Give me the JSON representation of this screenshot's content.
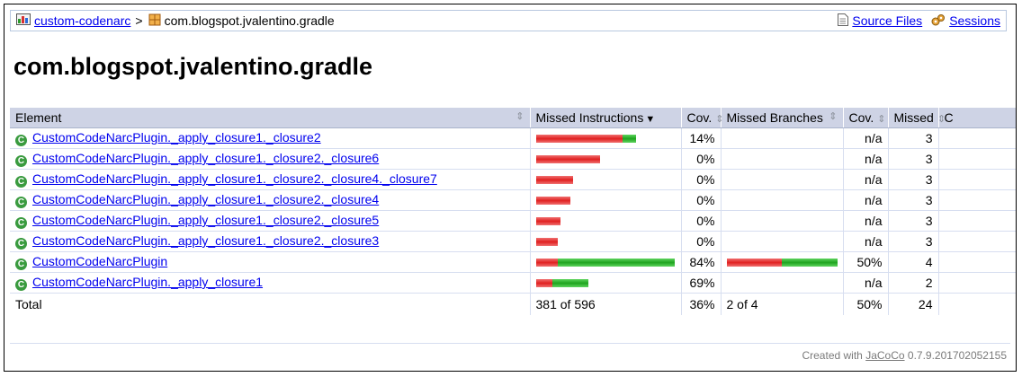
{
  "breadcrumb": {
    "root_label": "custom-codenarc",
    "separator": ">",
    "package_label": "com.blogspot.jvalentino.gradle",
    "source_files_label": "Source Files",
    "sessions_label": "Sessions"
  },
  "page_title": "com.blogspot.jvalentino.gradle",
  "table": {
    "headers": {
      "element": "Element",
      "missed_instructions": "Missed Instructions",
      "cov1": "Cov.",
      "missed_branches": "Missed Branches",
      "cov2": "Cov.",
      "missed": "Missed",
      "cxty": "C"
    },
    "rows": [
      {
        "name": "CustomCodeNarcPlugin._apply_closure1._closure2",
        "instr_cov": 0.14,
        "instr_missed_frac": 0.62,
        "cov1": "14%",
        "branch_missed_frac": null,
        "cov2": "n/a",
        "missed": "3"
      },
      {
        "name": "CustomCodeNarcPlugin._apply_closure1._closure2._closure6",
        "instr_cov": 0.0,
        "instr_missed_frac": 0.46,
        "cov1": "0%",
        "branch_missed_frac": null,
        "cov2": "n/a",
        "missed": "3"
      },
      {
        "name": "CustomCodeNarcPlugin._apply_closure1._closure2._closure4._closure7",
        "instr_cov": 0.0,
        "instr_missed_frac": 0.27,
        "cov1": "0%",
        "branch_missed_frac": null,
        "cov2": "n/a",
        "missed": "3"
      },
      {
        "name": "CustomCodeNarcPlugin._apply_closure1._closure2._closure4",
        "instr_cov": 0.0,
        "instr_missed_frac": 0.25,
        "cov1": "0%",
        "branch_missed_frac": null,
        "cov2": "n/a",
        "missed": "3"
      },
      {
        "name": "CustomCodeNarcPlugin._apply_closure1._closure2._closure5",
        "instr_cov": 0.0,
        "instr_missed_frac": 0.18,
        "cov1": "0%",
        "branch_missed_frac": null,
        "cov2": "n/a",
        "missed": "3"
      },
      {
        "name": "CustomCodeNarcPlugin._apply_closure1._closure2._closure3",
        "instr_cov": 0.0,
        "instr_missed_frac": 0.16,
        "cov1": "0%",
        "branch_missed_frac": null,
        "cov2": "n/a",
        "missed": "3"
      },
      {
        "name": "CustomCodeNarcPlugin",
        "instr_cov": 0.84,
        "instr_missed_frac": 0.15,
        "cov1": "84%",
        "branch_missed_frac": 0.5,
        "cov2": "50%",
        "missed": "4"
      },
      {
        "name": "CustomCodeNarcPlugin._apply_closure1",
        "instr_cov": 0.69,
        "instr_missed_frac": 0.12,
        "cov1": "69%",
        "branch_missed_frac": null,
        "cov2": "n/a",
        "missed": "2"
      }
    ],
    "total": {
      "label": "Total",
      "missed_instructions": "381 of 596",
      "cov1": "36%",
      "missed_branches": "2 of 4",
      "cov2": "50%",
      "missed": "24"
    }
  },
  "footer": {
    "prefix": "Created with",
    "jacoco_label": "JaCoCo",
    "version": "0.7.9.201702052155"
  },
  "colors": {
    "missed": "#e02020",
    "covered": "#1fa31f",
    "header_bg": "#ced3e5",
    "link": "#0000ee"
  }
}
